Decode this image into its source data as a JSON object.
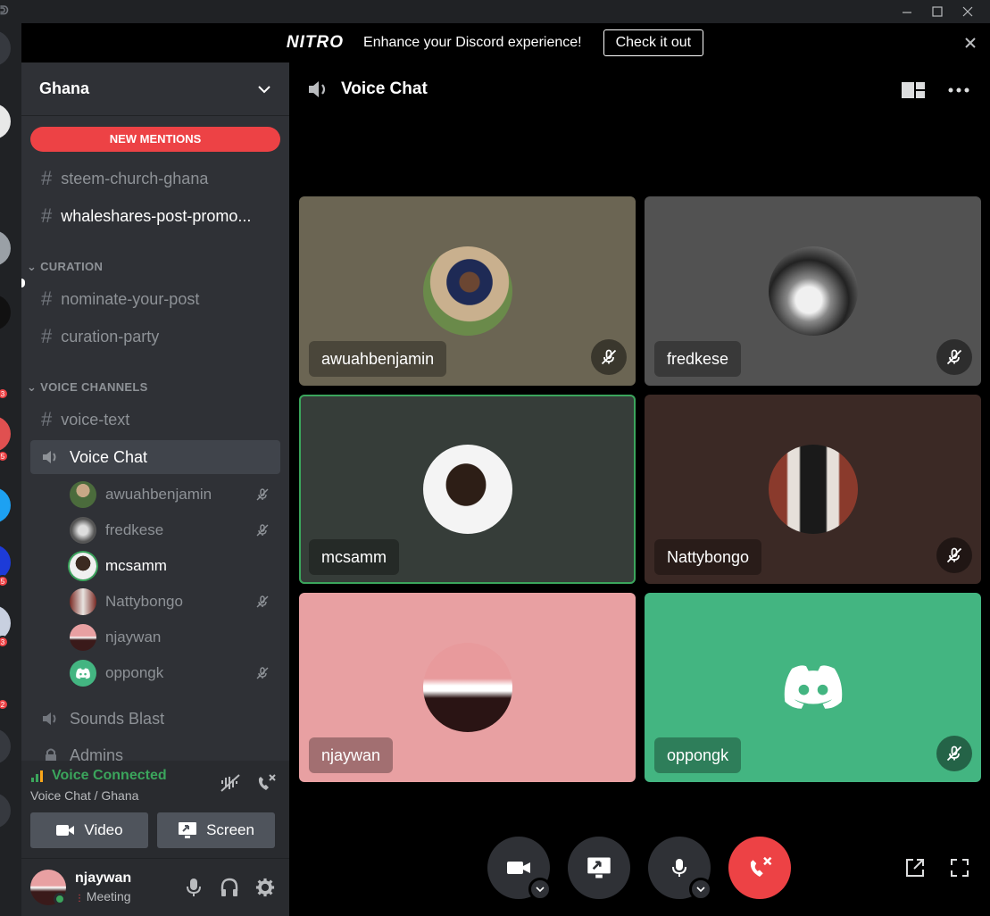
{
  "window": {
    "app_logo": "ᕲ"
  },
  "banner": {
    "brand": "NITRO",
    "text": "Enhance your Discord experience!",
    "button": "Check it out"
  },
  "server_badges": [
    "3",
    "5",
    "5",
    "3",
    "2"
  ],
  "guild": {
    "name": "Ghana"
  },
  "channels": {
    "mention_pill": "NEW MENTIONS",
    "top": [
      {
        "name": "steem-church-ghana",
        "unread": false
      },
      {
        "name": "whaleshares-post-promo...",
        "unread": true
      }
    ],
    "categories": [
      {
        "name": "CURATION",
        "channels": [
          "nominate-your-post",
          "curation-party"
        ]
      },
      {
        "name": "VOICE CHANNELS"
      }
    ],
    "voice_text": "voice-text",
    "active_voice": "Voice Chat",
    "voice_users": [
      {
        "name": "awuahbenjamin",
        "muted": true,
        "speaking": false
      },
      {
        "name": "fredkese",
        "muted": true,
        "speaking": false
      },
      {
        "name": "mcsamm",
        "muted": false,
        "speaking": true
      },
      {
        "name": "Nattybongo",
        "muted": true,
        "speaking": false
      },
      {
        "name": "njaywan",
        "muted": false,
        "speaking": false
      },
      {
        "name": "oppongk",
        "muted": true,
        "speaking": false
      }
    ],
    "sounds_blast": "Sounds Blast",
    "admins": "Admins"
  },
  "voice_panel": {
    "status": "Voice Connected",
    "location": "Voice Chat / Ghana",
    "video_label": "Video",
    "screen_label": "Screen"
  },
  "user_panel": {
    "name": "njaywan",
    "status": "Meeting"
  },
  "main": {
    "title": "Voice Chat",
    "tiles": [
      {
        "name": "awuahbenjamin",
        "bg": "#6b6553",
        "muted": true
      },
      {
        "name": "fredkese",
        "bg": "#525252",
        "muted": true
      },
      {
        "name": "mcsamm",
        "bg": "#363d39",
        "muted": false
      },
      {
        "name": "Nattybongo",
        "bg": "#3b2925",
        "muted": true
      },
      {
        "name": "njaywan",
        "bg": "#e8a0a2",
        "muted": false
      },
      {
        "name": "oppongk",
        "bg": "#43b581",
        "muted": true
      }
    ]
  },
  "colors": {
    "accent_green": "#3ba55c",
    "danger": "#ed4245",
    "blurple": "#5865f2"
  }
}
